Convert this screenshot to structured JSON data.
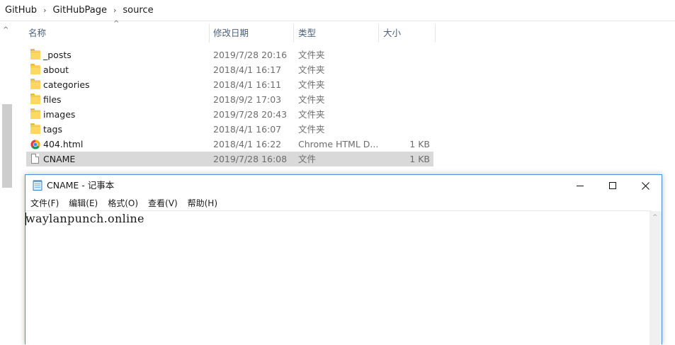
{
  "breadcrumb": [
    "GitHub",
    "GitHubPage",
    "source"
  ],
  "columns": {
    "name": "名称",
    "date": "修改日期",
    "type": "类型",
    "size": "大小"
  },
  "files": [
    {
      "name": "_posts",
      "date": "2019/7/28 20:16",
      "type": "文件夹",
      "size": "",
      "icon": "folder-icon"
    },
    {
      "name": "about",
      "date": "2018/4/1 16:17",
      "type": "文件夹",
      "size": "",
      "icon": "folder-icon"
    },
    {
      "name": "categories",
      "date": "2018/4/1 16:11",
      "type": "文件夹",
      "size": "",
      "icon": "folder-icon"
    },
    {
      "name": "files",
      "date": "2018/9/2 17:03",
      "type": "文件夹",
      "size": "",
      "icon": "folder-icon"
    },
    {
      "name": "images",
      "date": "2019/7/28 20:43",
      "type": "文件夹",
      "size": "",
      "icon": "folder-icon"
    },
    {
      "name": "tags",
      "date": "2018/4/1 16:07",
      "type": "文件夹",
      "size": "",
      "icon": "folder-icon"
    },
    {
      "name": "404.html",
      "date": "2018/4/1 16:22",
      "type": "Chrome HTML D...",
      "size": "1 KB",
      "icon": "chrome-icon"
    },
    {
      "name": "CNAME",
      "date": "2019/7/28 16:08",
      "type": "文件",
      "size": "1 KB",
      "icon": "file-icon",
      "selected": true
    }
  ],
  "notepad": {
    "title": "CNAME - 记事本",
    "menu": [
      "文件(F)",
      "编辑(E)",
      "格式(O)",
      "查看(V)",
      "帮助(H)"
    ],
    "content": "waylanpunch.online"
  },
  "colors": {
    "selected_row": "#d9d9d9",
    "window_border": "#4d8fd6",
    "folder": "#ffd862"
  }
}
